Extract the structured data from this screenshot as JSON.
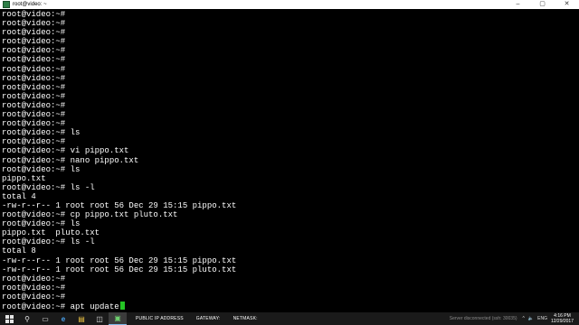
{
  "window": {
    "title": "root@video: ~",
    "buttons": [
      "–",
      "▢",
      "✕"
    ]
  },
  "terminal": {
    "lines": [
      "root@video:~#",
      "root@video:~#",
      "root@video:~#",
      "root@video:~#",
      "root@video:~#",
      "root@video:~#",
      "root@video:~#",
      "root@video:~#",
      "root@video:~#",
      "root@video:~#",
      "root@video:~#",
      "root@video:~#",
      "root@video:~#",
      "root@video:~# ls",
      "root@video:~#",
      "root@video:~# vi pippo.txt",
      "root@video:~# nano pippo.txt",
      "root@video:~# ls",
      "pippo.txt",
      "root@video:~# ls -l",
      "total 4",
      "-rw-r--r-- 1 root root 56 Dec 29 15:15 pippo.txt",
      "root@video:~# cp pippo.txt pluto.txt",
      "root@video:~# ls",
      "pippo.txt  pluto.txt",
      "root@video:~# ls -l",
      "total 8",
      "-rw-r--r-- 1 root root 56 Dec 29 15:15 pippo.txt",
      "-rw-r--r-- 1 root root 56 Dec 29 15:15 pluto.txt",
      "root@video:~#",
      "root@video:~#",
      "root@video:~#"
    ],
    "current_input": "root@video:~# apt update",
    "cursor_color": "#24c424"
  },
  "taskbar": {
    "icons": [
      {
        "name": "start-icon"
      },
      {
        "name": "search-icon",
        "glyph": "⚲"
      },
      {
        "name": "task-view-icon",
        "glyph": "▭"
      },
      {
        "name": "edge-icon",
        "glyph": "e"
      },
      {
        "name": "explorer-icon",
        "glyph": "▤"
      },
      {
        "name": "store-icon",
        "glyph": "◫"
      },
      {
        "name": "terminal-app-icon",
        "glyph": "▣"
      }
    ],
    "network_labels": [
      "PUBLIC IP ADDRESS",
      "GATEWAY:",
      "NETMASK:"
    ],
    "status_text": "Server disconnected (ssh: 30035)",
    "tray": {
      "expand": "^",
      "language": "ENG"
    },
    "clock": {
      "time": "4:16 PM",
      "date": "12/29/2017"
    }
  }
}
